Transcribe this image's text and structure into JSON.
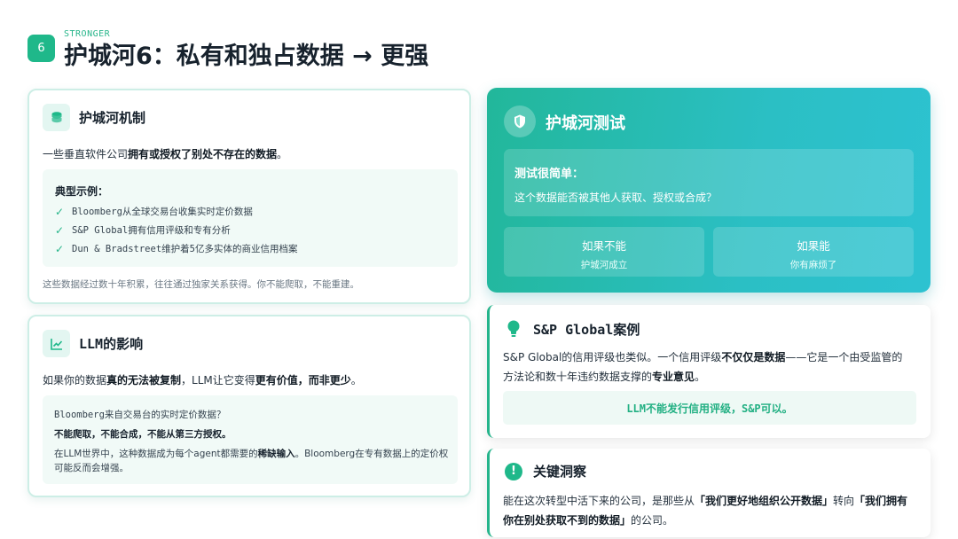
{
  "header": {
    "number": "6",
    "eyebrow": "STRONGER",
    "title": "护城河6：私有和独占数据 → 更强"
  },
  "mechanism_card": {
    "icon": "database-icon",
    "title": "护城河机制",
    "intro_before": "一些垂直软件公司",
    "intro_bold": "拥有或授权了别处不存在的数据",
    "intro_after": "。",
    "examples_title": "典型示例：",
    "examples": [
      "Bloomberg从全球交易台收集实时定价数据",
      "S&P Global拥有信用评级和专有分析",
      "Dun & Bradstreet维护着5亿多实体的商业信用档案"
    ],
    "footnote": "这些数据经过数十年积累，往往通过独家关系获得。你不能爬取，不能重建。"
  },
  "llm_card": {
    "icon": "trend-chart-icon",
    "title": "LLM的影响",
    "intro_a": "如果你的数据",
    "intro_b": "真的无法被复制",
    "intro_c": "，LLM让它变得",
    "intro_d": "更有价值，而非更少",
    "intro_e": "。",
    "box_line1": "Bloomberg来自交易台的实时定价数据？",
    "box_line2": "不能爬取，不能合成，不能从第三方授权。",
    "box_line3_a": "在LLM世界中，这种数据成为每个agent都需要的",
    "box_line3_b": "稀缺输入",
    "box_line3_c": "。Bloomberg在专有数据上的定价权",
    "box_line4": "可能反而会增强。"
  },
  "moat_test": {
    "icon": "shield-icon",
    "title": "护城河测试",
    "box_title": "测试很简单：",
    "box_question": "这个数据能否被其他人获取、授权或合成？",
    "option_no_main": "如果不能",
    "option_no_sub": "护城河成立",
    "option_yes_main": "如果能",
    "option_yes_sub": "你有麻烦了"
  },
  "sp_case": {
    "icon": "lightbulb-icon",
    "title_a": "S&P Global",
    "title_b": "案例",
    "line1_a": "S&P Global的信用评级也类似。一个信用评级",
    "line1_b": "不仅仅是数据",
    "line1_c": "——它是一个由受监管的",
    "line2_a": "方法论和数十年违约数据支撑的",
    "line2_b": "专业意见",
    "line2_c": "。",
    "highlight": "LLM不能发行信用评级，S&P可以。"
  },
  "insight": {
    "icon": "info-icon",
    "title": "关键洞察",
    "line1_a": "能在这次转型中活下来的公司，是那些从",
    "line1_b": "「我们更好地组织公开数据」",
    "line1_c": "转向",
    "line1_d": "「我们拥有",
    "line2_a": "你在别处获取不到的数据」",
    "line2_b": "的公司。"
  },
  "colors": {
    "accent": "#1fb88a",
    "teal_start": "#22b79a",
    "teal_end": "#2dc2d1"
  }
}
